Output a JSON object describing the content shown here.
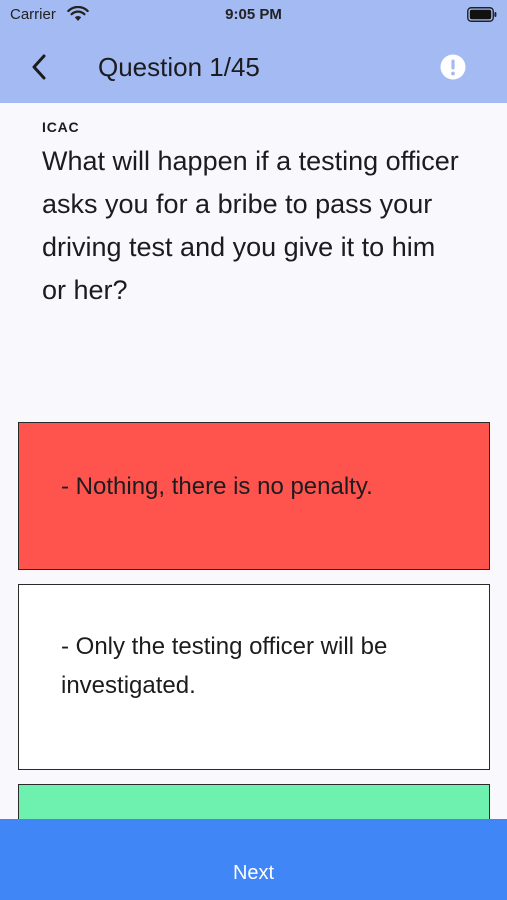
{
  "status_bar": {
    "carrier": "Carrier",
    "time": "9:05 PM",
    "wifi_icon": "wifi-icon",
    "battery_icon": "battery-icon"
  },
  "header": {
    "back_icon": "chevron-left-icon",
    "title": "Question 1/45",
    "report_icon": "exclamation-circle-icon",
    "background_color": "#a4baf3"
  },
  "question": {
    "category": "ICAC",
    "text": "What will happen if a testing officer asks you for a bribe to pass your driving test and you give it to him or her?"
  },
  "answers": [
    {
      "text": "- Nothing, there is no penalty.",
      "color": "#ff534e",
      "state": "incorrect"
    },
    {
      "text": "- Only the testing officer will be investigated.",
      "color": "#ffffff",
      "state": "neutral"
    },
    {
      "text": "",
      "color": "#6ef1ae",
      "state": "correct"
    }
  ],
  "footer": {
    "next_label": "Next",
    "background_color": "#4186f7"
  }
}
